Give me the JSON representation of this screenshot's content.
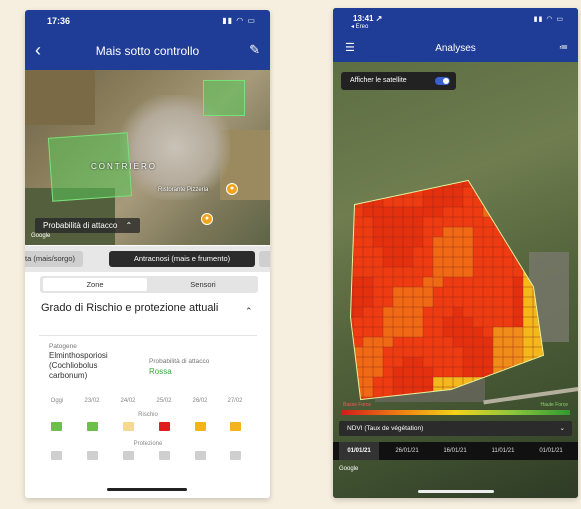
{
  "phone1": {
    "status_time": "17:36",
    "status_icons": "▮▮ ◠ ▭",
    "nav": {
      "back_icon": "‹",
      "title": "Mais sotto controllo",
      "edit_icon": "✎"
    },
    "map": {
      "town_label": "CONTRIERO",
      "poi_label": "Ristorante Pizzeria",
      "probability_chip": "Probabilità di attacco",
      "chip_chevron": "⌃",
      "google": "Google"
    },
    "filters": [
      "ta (mais/sorgo)",
      "Antracnosi (mais e frumento)",
      ""
    ],
    "segments": [
      "Zone",
      "Sensori"
    ],
    "card": {
      "title": "Grado di Rischio e protezione attuali",
      "chevron": "⌃",
      "pathogen_label": "Patogene",
      "pathogen_value": "Elminthosporiosi (Cochliobolus carbonum)",
      "probability_label": "Probabilità di attacco",
      "probability_value": "Rossa",
      "days": [
        "Oggi",
        "23/02",
        "24/02",
        "25/02",
        "26/02",
        "27/02"
      ],
      "risk_title": "Rischio",
      "protection_title": "Protezione",
      "risk_colors": [
        "#6cc04a",
        "#6cc04a",
        "#f5d98c",
        "#e01e1e",
        "#f4b21b",
        "#f4b21b"
      ],
      "protection_colors": [
        "#cfcfcf",
        "#cfcfcf",
        "#cfcfcf",
        "#cfcfcf",
        "#cfcfcf",
        "#cfcfcf"
      ]
    }
  },
  "phone2": {
    "status_time": "13:41 ↗",
    "status_sub": "◂ Ereo",
    "status_icons": "▮▮ ◠ ▭",
    "nav": {
      "menu_icon": "☰",
      "title": "Analyses",
      "list_icon": "≔"
    },
    "satellite_toggle": "Afficher le satellite",
    "legend_left": "Basse Force",
    "legend_right": "Haute Force",
    "index_label": "NDVI (Taux de végétation)",
    "index_chevron": "⌄",
    "dates": [
      "01/01/21",
      "26/01/21",
      "16/01/21",
      "11/01/21",
      "01/01/21"
    ],
    "google": "Google"
  }
}
